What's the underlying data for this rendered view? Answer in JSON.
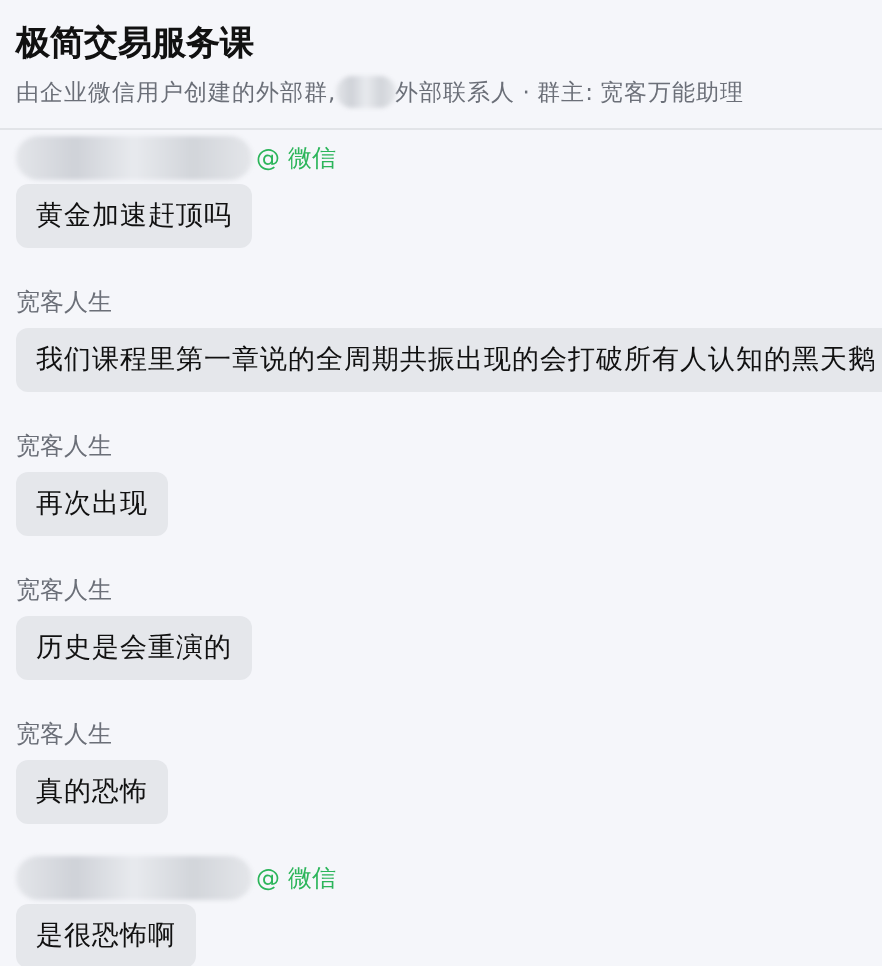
{
  "header": {
    "title": "极简交易服务课",
    "subtitle_before": "由企业微信用户创建的外部群, ",
    "subtitle_after": "外部联系人 · 群主: 宽客万能助理"
  },
  "messages": [
    {
      "sender": {
        "kind": "redacted",
        "suffix": "@ 微信"
      },
      "text": "黄金加速赶顶吗"
    },
    {
      "sender": {
        "kind": "named",
        "name": "宽客人生"
      },
      "text": "我们课程里第一章说的全周期共振出现的会打破所有人认知的黑天鹅"
    },
    {
      "sender": {
        "kind": "named",
        "name": "宽客人生"
      },
      "text": "再次出现"
    },
    {
      "sender": {
        "kind": "named",
        "name": "宽客人生"
      },
      "text": "历史是会重演的"
    },
    {
      "sender": {
        "kind": "named",
        "name": "宽客人生"
      },
      "text": "真的恐怖"
    },
    {
      "sender": {
        "kind": "redacted",
        "suffix": "@ 微信"
      },
      "text": "是很恐怖啊"
    }
  ]
}
